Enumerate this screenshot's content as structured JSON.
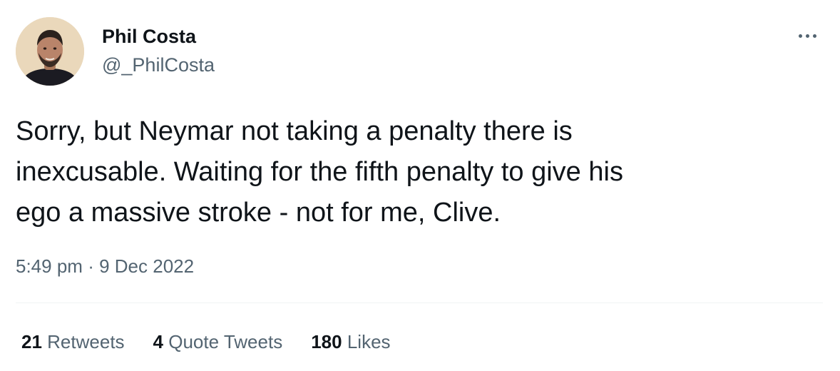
{
  "author": {
    "name": "Phil Costa",
    "handle": "@_PhilCosta"
  },
  "tweet": {
    "lines": [
      "Sorry, but Neymar not taking a penalty there is",
      "inexcusable. Waiting for the fifth penalty to give his",
      "ego a massive stroke - not for me, Clive."
    ],
    "time": "5:49 pm",
    "separator": "·",
    "date": "9 Dec 2022"
  },
  "stats": [
    {
      "count": "21",
      "label": "Retweets"
    },
    {
      "count": "4",
      "label": "Quote Tweets"
    },
    {
      "count": "180",
      "label": "Likes"
    }
  ],
  "icons": {
    "more": "more-horizontal-icon"
  },
  "colors": {
    "text_primary": "#0f1419",
    "text_secondary": "#536471",
    "divider": "#eff3f4"
  }
}
